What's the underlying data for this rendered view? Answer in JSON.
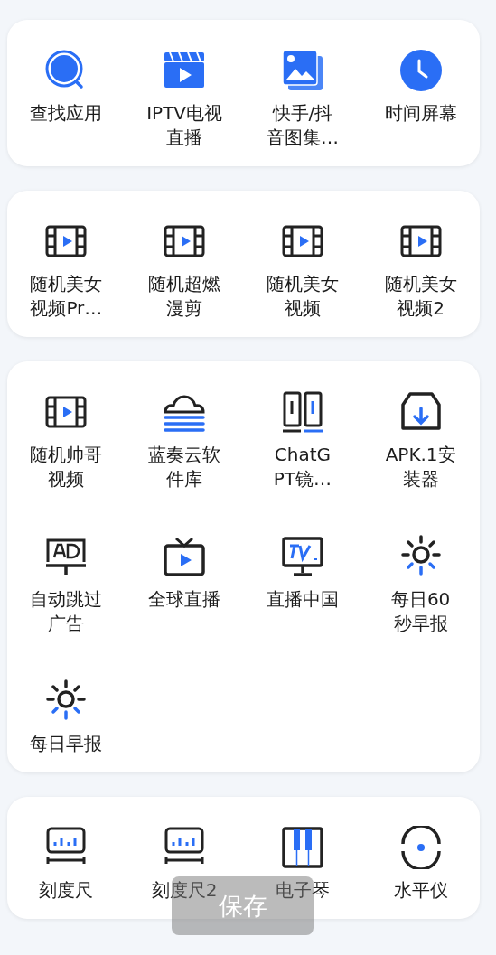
{
  "groups": [
    {
      "items": [
        {
          "kind": "search",
          "label": [
            "查找应用"
          ]
        },
        {
          "kind": "clapper",
          "label": [
            "IPTV电视",
            "直播"
          ]
        },
        {
          "kind": "gallery",
          "label": [
            "快手/抖",
            "音图集…"
          ]
        },
        {
          "kind": "clock",
          "label": [
            "时间屏幕"
          ]
        }
      ]
    },
    {
      "items": [
        {
          "kind": "film",
          "label": [
            "随机美女",
            "视频Pr…"
          ]
        },
        {
          "kind": "film",
          "label": [
            "随机超燃",
            "漫剪"
          ]
        },
        {
          "kind": "film",
          "label": [
            "随机美女",
            "视频"
          ]
        },
        {
          "kind": "film",
          "label": [
            "随机美女",
            "视频2"
          ]
        }
      ]
    },
    {
      "items": [
        {
          "kind": "film",
          "label": [
            "随机帅哥",
            "视频"
          ]
        },
        {
          "kind": "cloud",
          "label": [
            "蓝奏云软",
            "件库"
          ]
        },
        {
          "kind": "panels",
          "label": [
            "ChatG",
            "PT镜…"
          ]
        },
        {
          "kind": "box",
          "label": [
            "APK.1安",
            "装器"
          ]
        },
        {
          "kind": "ad",
          "label": [
            "自动跳过",
            "广告"
          ]
        },
        {
          "kind": "tv",
          "label": [
            "全球直播"
          ]
        },
        {
          "kind": "monitor",
          "label": [
            "直播中国"
          ]
        },
        {
          "kind": "sun",
          "label": [
            "每日60",
            "秒早报"
          ]
        },
        {
          "kind": "sun",
          "label": [
            "每日早报"
          ]
        }
      ]
    },
    {
      "items": [
        {
          "kind": "ruler",
          "label": [
            "刻度尺"
          ]
        },
        {
          "kind": "ruler",
          "label": [
            "刻度尺2"
          ]
        },
        {
          "kind": "piano",
          "label": [
            "电子琴"
          ]
        },
        {
          "kind": "level",
          "label": [
            "水平仪"
          ]
        }
      ]
    }
  ],
  "toast": "保存"
}
